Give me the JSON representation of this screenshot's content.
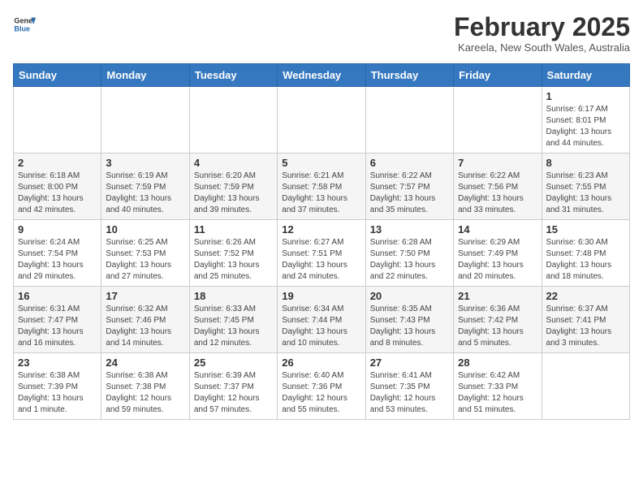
{
  "header": {
    "logo_general": "General",
    "logo_blue": "Blue",
    "month_title": "February 2025",
    "location": "Kareela, New South Wales, Australia"
  },
  "weekdays": [
    "Sunday",
    "Monday",
    "Tuesday",
    "Wednesday",
    "Thursday",
    "Friday",
    "Saturday"
  ],
  "weeks": [
    [
      {
        "day": "",
        "info": ""
      },
      {
        "day": "",
        "info": ""
      },
      {
        "day": "",
        "info": ""
      },
      {
        "day": "",
        "info": ""
      },
      {
        "day": "",
        "info": ""
      },
      {
        "day": "",
        "info": ""
      },
      {
        "day": "1",
        "info": "Sunrise: 6:17 AM\nSunset: 8:01 PM\nDaylight: 13 hours and 44 minutes."
      }
    ],
    [
      {
        "day": "2",
        "info": "Sunrise: 6:18 AM\nSunset: 8:00 PM\nDaylight: 13 hours and 42 minutes."
      },
      {
        "day": "3",
        "info": "Sunrise: 6:19 AM\nSunset: 7:59 PM\nDaylight: 13 hours and 40 minutes."
      },
      {
        "day": "4",
        "info": "Sunrise: 6:20 AM\nSunset: 7:59 PM\nDaylight: 13 hours and 39 minutes."
      },
      {
        "day": "5",
        "info": "Sunrise: 6:21 AM\nSunset: 7:58 PM\nDaylight: 13 hours and 37 minutes."
      },
      {
        "day": "6",
        "info": "Sunrise: 6:22 AM\nSunset: 7:57 PM\nDaylight: 13 hours and 35 minutes."
      },
      {
        "day": "7",
        "info": "Sunrise: 6:22 AM\nSunset: 7:56 PM\nDaylight: 13 hours and 33 minutes."
      },
      {
        "day": "8",
        "info": "Sunrise: 6:23 AM\nSunset: 7:55 PM\nDaylight: 13 hours and 31 minutes."
      }
    ],
    [
      {
        "day": "9",
        "info": "Sunrise: 6:24 AM\nSunset: 7:54 PM\nDaylight: 13 hours and 29 minutes."
      },
      {
        "day": "10",
        "info": "Sunrise: 6:25 AM\nSunset: 7:53 PM\nDaylight: 13 hours and 27 minutes."
      },
      {
        "day": "11",
        "info": "Sunrise: 6:26 AM\nSunset: 7:52 PM\nDaylight: 13 hours and 25 minutes."
      },
      {
        "day": "12",
        "info": "Sunrise: 6:27 AM\nSunset: 7:51 PM\nDaylight: 13 hours and 24 minutes."
      },
      {
        "day": "13",
        "info": "Sunrise: 6:28 AM\nSunset: 7:50 PM\nDaylight: 13 hours and 22 minutes."
      },
      {
        "day": "14",
        "info": "Sunrise: 6:29 AM\nSunset: 7:49 PM\nDaylight: 13 hours and 20 minutes."
      },
      {
        "day": "15",
        "info": "Sunrise: 6:30 AM\nSunset: 7:48 PM\nDaylight: 13 hours and 18 minutes."
      }
    ],
    [
      {
        "day": "16",
        "info": "Sunrise: 6:31 AM\nSunset: 7:47 PM\nDaylight: 13 hours and 16 minutes."
      },
      {
        "day": "17",
        "info": "Sunrise: 6:32 AM\nSunset: 7:46 PM\nDaylight: 13 hours and 14 minutes."
      },
      {
        "day": "18",
        "info": "Sunrise: 6:33 AM\nSunset: 7:45 PM\nDaylight: 13 hours and 12 minutes."
      },
      {
        "day": "19",
        "info": "Sunrise: 6:34 AM\nSunset: 7:44 PM\nDaylight: 13 hours and 10 minutes."
      },
      {
        "day": "20",
        "info": "Sunrise: 6:35 AM\nSunset: 7:43 PM\nDaylight: 13 hours and 8 minutes."
      },
      {
        "day": "21",
        "info": "Sunrise: 6:36 AM\nSunset: 7:42 PM\nDaylight: 13 hours and 5 minutes."
      },
      {
        "day": "22",
        "info": "Sunrise: 6:37 AM\nSunset: 7:41 PM\nDaylight: 13 hours and 3 minutes."
      }
    ],
    [
      {
        "day": "23",
        "info": "Sunrise: 6:38 AM\nSunset: 7:39 PM\nDaylight: 13 hours and 1 minute."
      },
      {
        "day": "24",
        "info": "Sunrise: 6:38 AM\nSunset: 7:38 PM\nDaylight: 12 hours and 59 minutes."
      },
      {
        "day": "25",
        "info": "Sunrise: 6:39 AM\nSunset: 7:37 PM\nDaylight: 12 hours and 57 minutes."
      },
      {
        "day": "26",
        "info": "Sunrise: 6:40 AM\nSunset: 7:36 PM\nDaylight: 12 hours and 55 minutes."
      },
      {
        "day": "27",
        "info": "Sunrise: 6:41 AM\nSunset: 7:35 PM\nDaylight: 12 hours and 53 minutes."
      },
      {
        "day": "28",
        "info": "Sunrise: 6:42 AM\nSunset: 7:33 PM\nDaylight: 12 hours and 51 minutes."
      },
      {
        "day": "",
        "info": ""
      }
    ]
  ]
}
